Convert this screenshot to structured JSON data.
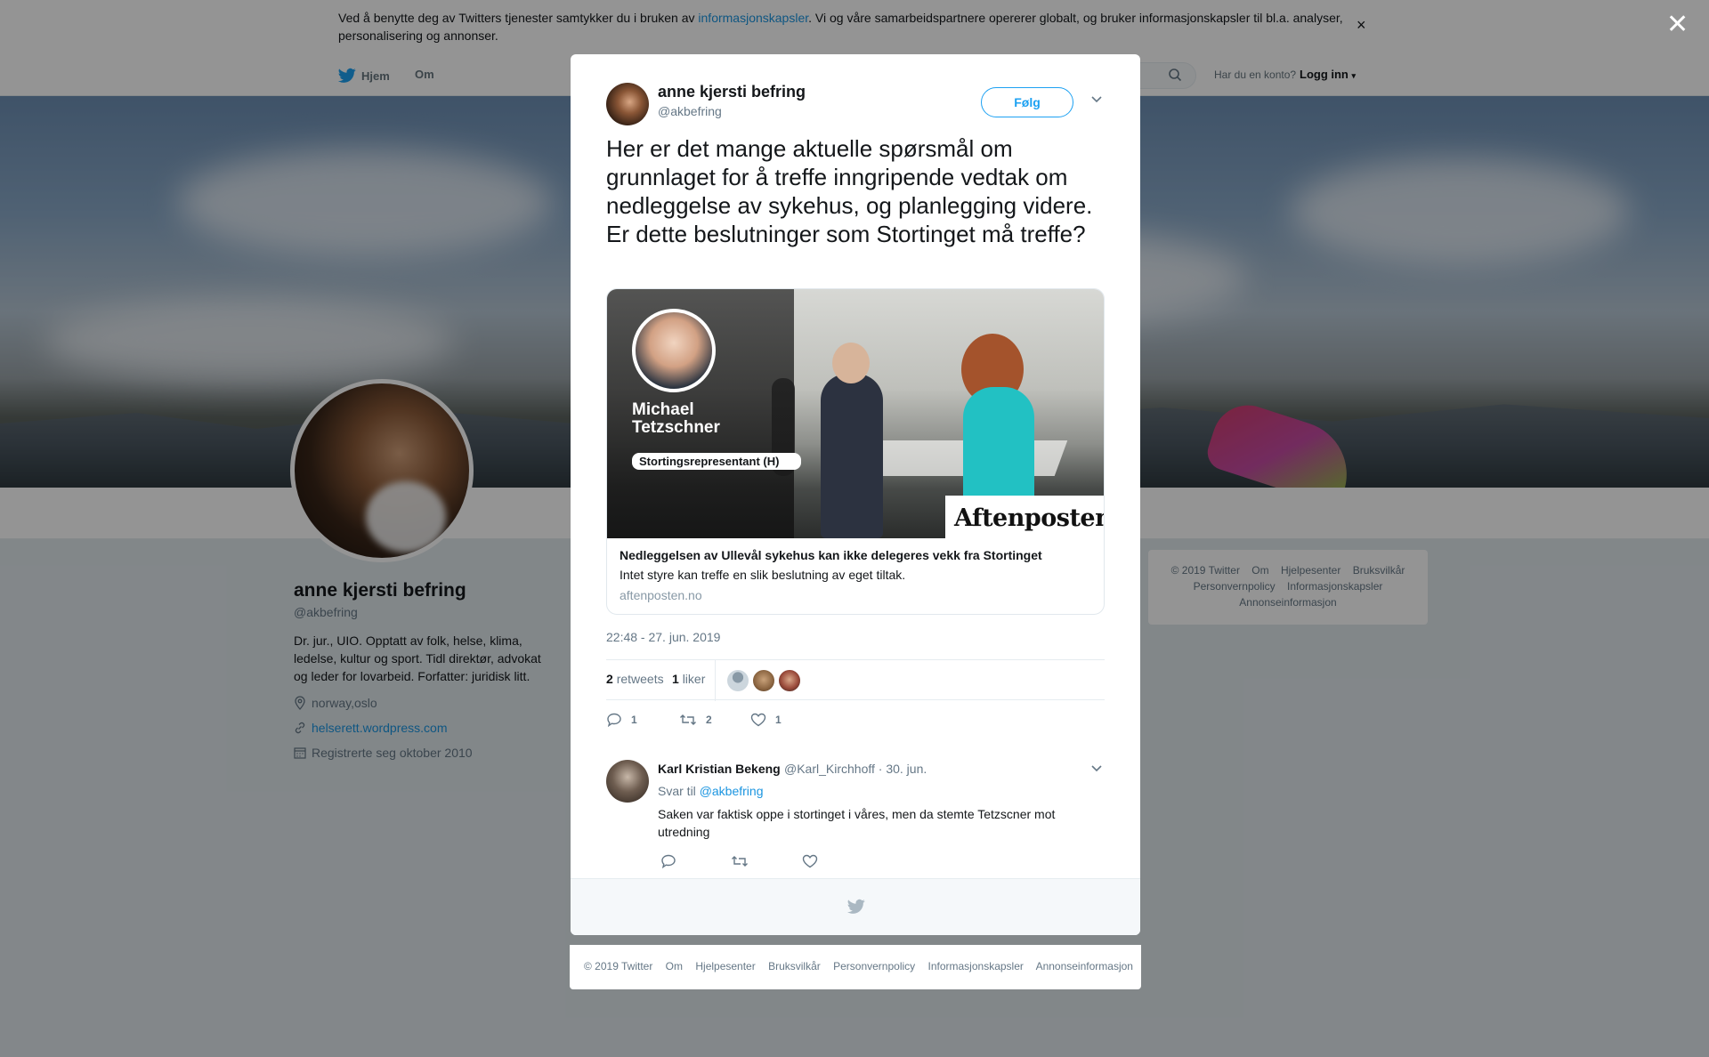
{
  "cookie_banner": {
    "text_before": "Ved å benytte deg av Twitters tjenester samtykker du i bruken av ",
    "link": "informasjonskapsler",
    "text_after": ". Vi og våre samarbeidspartnere opererer globalt, og bruker informasjonskapsler til bl.a. analyser, personalisering og annonser.",
    "close": "×"
  },
  "nav": {
    "home": "Hjem",
    "about": "Om",
    "account_prompt": "Har du en konto?",
    "login": "Logg inn"
  },
  "profile": {
    "name": "anne kjersti befring",
    "handle": "@akbefring",
    "bio": "Dr. jur., UIO. Opptatt av folk, helse, klima, ledelse, kultur og sport. Tidl direktør, advokat og leder for lovarbeid. Forfatter: juridisk litt.",
    "location": "norway,oslo",
    "website": "helserett.wordpress.com",
    "joined": "Registrerte seg oktober 2010"
  },
  "side_footer": {
    "items": [
      "© 2019 Twitter",
      "Om",
      "Hjelpesenter",
      "Bruksvilkår",
      "Personvernpolicy",
      "Informasjonskapsler",
      "Annonseinformasjon"
    ]
  },
  "overlay_close": "✕",
  "tweet": {
    "author_name": "anne kjersti befring",
    "author_handle": "@akbefring",
    "follow_label": "Følg",
    "text": "Her er det mange aktuelle spørsmål om grunnlaget for å treffe inngripende vedtak om nedleggelse av sykehus, og planlegging videre. Er dette beslutninger som Stortinget må treffe?",
    "card": {
      "image_name_line1": "Michael",
      "image_name_line2": "Tetzschner",
      "image_role": "Stortingsrepresentant (H)",
      "image_brand": "Aftenposten",
      "title": "Nedleggelsen av Ullevål sykehus kan ikke delegeres vekk fra Stortinget",
      "description": "Intet styre kan treffe en slik beslutning av eget tiltak.",
      "domain": "aftenposten.no"
    },
    "timestamp": "22:48 - 27. jun. 2019",
    "retweets_count": "2",
    "retweets_label": "retweets",
    "likes_count": "1",
    "likes_label": "liker",
    "actions": {
      "replies": "1",
      "retweets": "2",
      "likes": "1"
    }
  },
  "reply": {
    "name": "Karl Kristian Bekeng",
    "handle_date": "@Karl_Kirchhoff · 30. jun.",
    "reply_to_label": "Svar til",
    "reply_to_handle": "@akbefring",
    "text": "Saken var faktisk oppe i stortinget i våres, men da stemte Tetzscner mot utredning"
  },
  "footer": {
    "items": [
      "© 2019 Twitter",
      "Om",
      "Hjelpesenter",
      "Bruksvilkår",
      "Personvernpolicy",
      "Informasjonskapsler",
      "Annonseinformasjon"
    ]
  },
  "colors": {
    "accent": "#1da1f2",
    "link": "#1b95e0",
    "muted": "#657786",
    "text": "#14171a"
  }
}
